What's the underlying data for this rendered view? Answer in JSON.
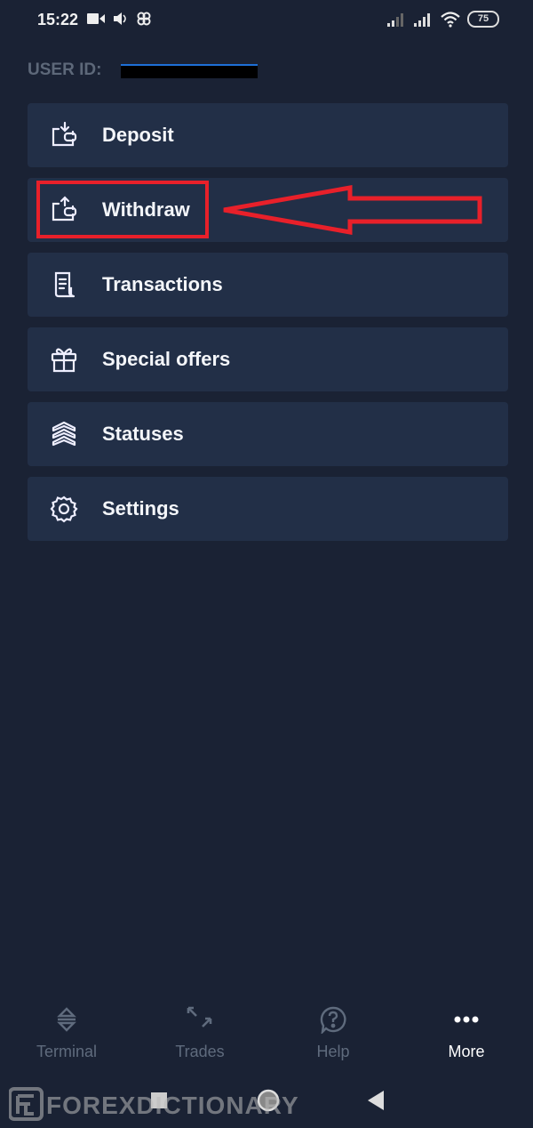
{
  "status_bar": {
    "time": "15:22",
    "battery": "75"
  },
  "user": {
    "label": "USER ID:",
    "id_redacted": true
  },
  "menu": {
    "items": [
      {
        "label": "Deposit",
        "icon": "wallet-in-icon"
      },
      {
        "label": "Withdraw",
        "icon": "wallet-out-icon"
      },
      {
        "label": "Transactions",
        "icon": "receipt-icon"
      },
      {
        "label": "Special offers",
        "icon": "gift-icon"
      },
      {
        "label": "Statuses",
        "icon": "layers-icon"
      },
      {
        "label": "Settings",
        "icon": "gear-icon"
      }
    ],
    "highlighted": "Withdraw"
  },
  "bottom_nav": {
    "tabs": [
      {
        "label": "Terminal",
        "icon": "terminal-icon"
      },
      {
        "label": "Trades",
        "icon": "trades-icon"
      },
      {
        "label": "Help",
        "icon": "help-icon"
      },
      {
        "label": "More",
        "icon": "more-icon",
        "active": true
      }
    ]
  },
  "watermark": "FOREXDICTIONARY",
  "colors": {
    "background": "#1a2234",
    "card": "#222f47",
    "annotation": "#e8202a",
    "inactive": "#5f6b7d"
  }
}
